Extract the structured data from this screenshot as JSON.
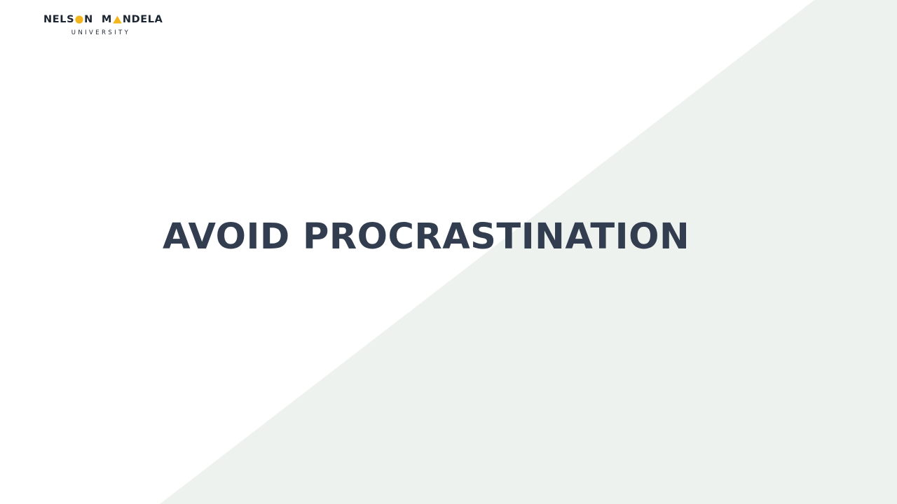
{
  "colors": {
    "background": "#ffffff",
    "diagonal_fill": "#eef2ef",
    "title_text": "#323e4f",
    "logo_text": "#1b2431",
    "logo_accent": "#f2b61c"
  },
  "logo": {
    "word1_before_mark": "NELS",
    "word1_after_mark": "N",
    "word1_mark_icon": "sun-circle-icon",
    "word2_before_mark": "M",
    "word2_after_mark": "NDELA",
    "word2_mark_icon": "triangle-icon",
    "subtitle": "UNIVERSITY"
  },
  "slide": {
    "title": "AVOID PROCRASTINATION"
  }
}
